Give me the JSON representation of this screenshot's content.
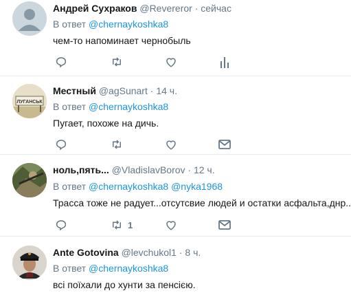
{
  "tweets": [
    {
      "name": "Андрей Сухраков",
      "handle": "@Revereror",
      "time": "сейчас",
      "reply_prefix": "В ответ",
      "reply_to": "@chernaykoshka8",
      "reply_to2": "",
      "text": "чем-то напоминает чернобыль",
      "retweets": "",
      "actions": [
        "reply-icon",
        "retweet-icon",
        "like-icon",
        "analytics-icon"
      ]
    },
    {
      "name": "Местный",
      "handle": "@agSunart",
      "time": "14 ч.",
      "reply_prefix": "В ответ",
      "reply_to": "@chernaykoshka8",
      "reply_to2": "",
      "text": "Пугает, похоже на дичь.",
      "retweets": "",
      "avatar_sign": "ЛУГАНСЬК",
      "actions": [
        "reply-icon",
        "retweet-icon",
        "like-icon",
        "message-icon"
      ]
    },
    {
      "name": "ноль,пять...",
      "handle": "@VladislavBorov",
      "time": "12 ч.",
      "reply_prefix": "В ответ",
      "reply_to": "@chernaykoshka8",
      "reply_to2": "@nyka1968",
      "text": "Трасса тоже не радует...отсутсвие людей и остатки асфальта,днр...",
      "retweets": "1",
      "actions": [
        "reply-icon",
        "retweet-icon",
        "like-icon",
        "message-icon"
      ]
    },
    {
      "name": "Ante Gotovina",
      "handle": "@levchukol1",
      "time": "8 ч.",
      "reply_prefix": "В ответ",
      "reply_to": "@chernaykoshka8",
      "reply_to2": "",
      "text": "всі поїхали до хунти за пенсією.",
      "retweets": "",
      "actions": []
    }
  ],
  "colors": {
    "link": "#1b95e0",
    "muted": "#657786",
    "text": "#14171a",
    "separator": "#e6ecf0"
  }
}
